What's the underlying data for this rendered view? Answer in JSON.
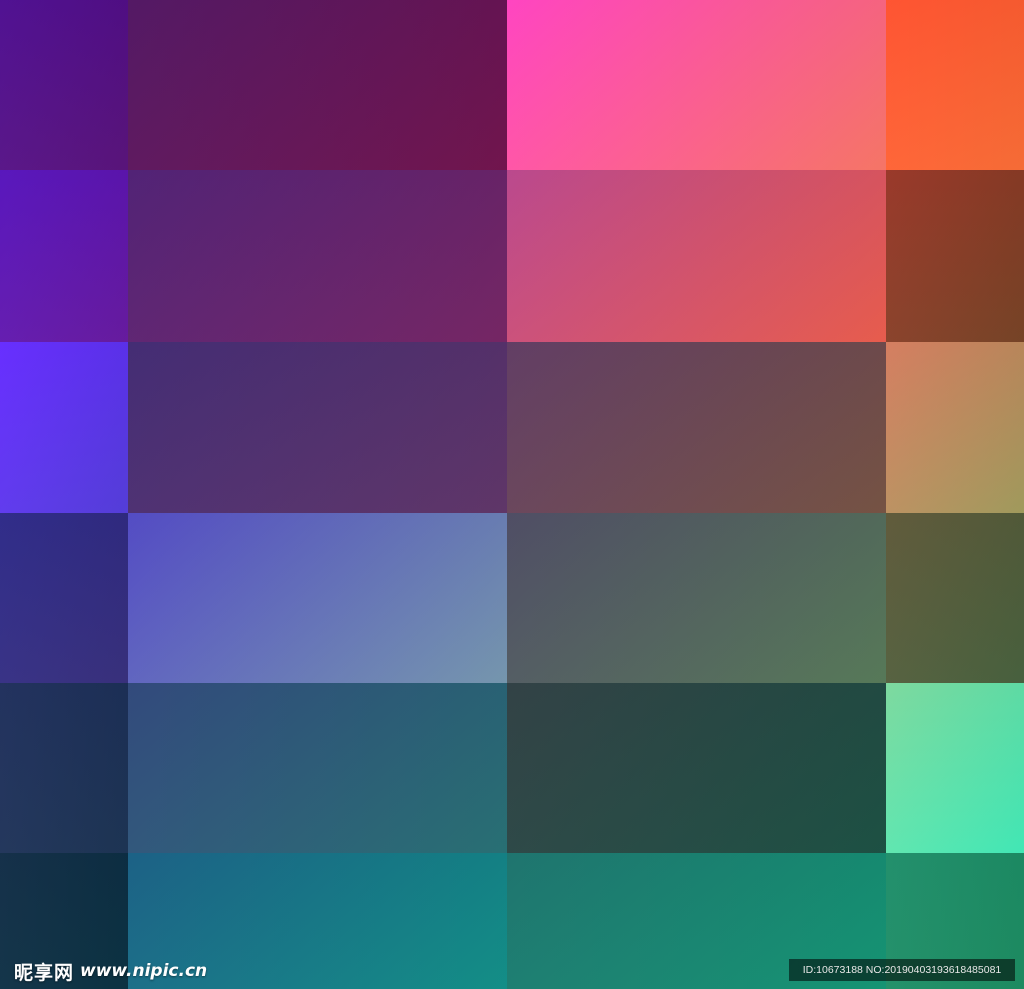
{
  "watermark": {
    "brand": "昵享网",
    "url": "www.nipic.cn"
  },
  "id_label": "ID:10673188 NO:20190403193618485081",
  "tiles": [
    {
      "from": "#4b0a8f",
      "to": "#5c157e"
    },
    {
      "from": "#4e1260",
      "to": "#751650"
    },
    {
      "from": "#ff3fbf",
      "to": "#ff7a6a"
    },
    {
      "from": "#ff4f2c",
      "to": "#ff7038"
    },
    {
      "from": "#5410bb",
      "to": "#6a1ca4"
    },
    {
      "from": "#4c1c72",
      "to": "#7a2868"
    },
    {
      "from": "#b8438a",
      "to": "#f06050"
    },
    {
      "from": "#973324",
      "to": "#7a4628"
    },
    {
      "from": "#6328ff",
      "to": "#5740e0"
    },
    {
      "from": "#3e2670",
      "to": "#63386c"
    },
    {
      "from": "#5d3860",
      "to": "#7a5646"
    },
    {
      "from": "#d47a5c",
      "to": "#a6a060"
    },
    {
      "from": "#2a2686",
      "to": "#3a3280"
    },
    {
      "from": "#4e46c2",
      "to": "#7a9cb4"
    },
    {
      "from": "#4a4860",
      "to": "#5a7e5c"
    },
    {
      "from": "#5c5636",
      "to": "#4a6440"
    },
    {
      "from": "#1c2c5a",
      "to": "#1e3656"
    },
    {
      "from": "#2c4478",
      "to": "#2a7478"
    },
    {
      "from": "#2c3c40",
      "to": "#1e5446"
    },
    {
      "from": "#7ad89c",
      "to": "#44f0bc"
    },
    {
      "from": "#0e2a44",
      "to": "#0c3444"
    },
    {
      "from": "#155c82",
      "to": "#14948c"
    },
    {
      "from": "#18706a",
      "to": "#169a78"
    },
    {
      "from": "#1c8c68",
      "to": "#1e9064"
    }
  ]
}
